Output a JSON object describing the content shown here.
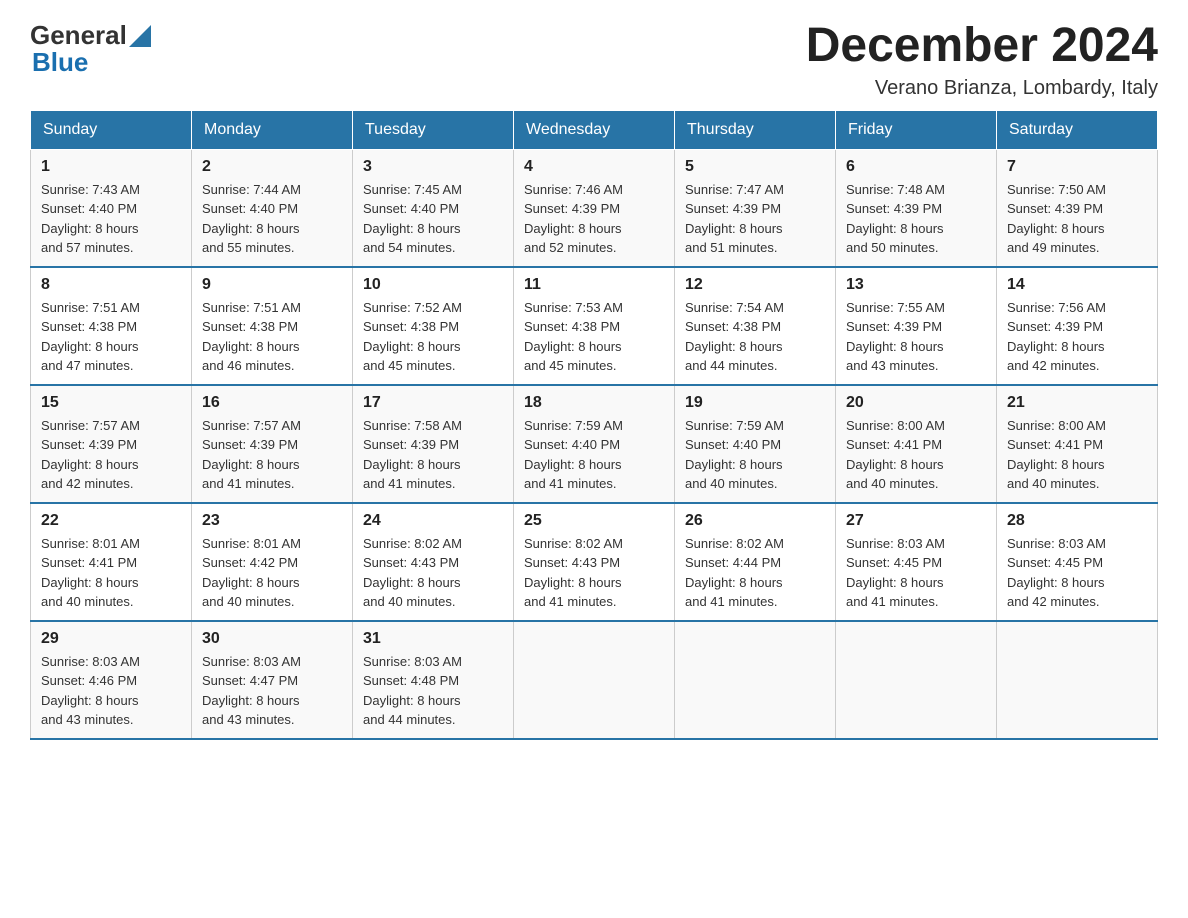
{
  "header": {
    "logo_general": "General",
    "logo_blue": "Blue",
    "month_title": "December 2024",
    "location": "Verano Brianza, Lombardy, Italy"
  },
  "days_of_week": [
    "Sunday",
    "Monday",
    "Tuesday",
    "Wednesday",
    "Thursday",
    "Friday",
    "Saturday"
  ],
  "weeks": [
    [
      {
        "day": "1",
        "sunrise": "7:43 AM",
        "sunset": "4:40 PM",
        "daylight_hours": "8",
        "daylight_minutes": "57"
      },
      {
        "day": "2",
        "sunrise": "7:44 AM",
        "sunset": "4:40 PM",
        "daylight_hours": "8",
        "daylight_minutes": "55"
      },
      {
        "day": "3",
        "sunrise": "7:45 AM",
        "sunset": "4:40 PM",
        "daylight_hours": "8",
        "daylight_minutes": "54"
      },
      {
        "day": "4",
        "sunrise": "7:46 AM",
        "sunset": "4:39 PM",
        "daylight_hours": "8",
        "daylight_minutes": "52"
      },
      {
        "day": "5",
        "sunrise": "7:47 AM",
        "sunset": "4:39 PM",
        "daylight_hours": "8",
        "daylight_minutes": "51"
      },
      {
        "day": "6",
        "sunrise": "7:48 AM",
        "sunset": "4:39 PM",
        "daylight_hours": "8",
        "daylight_minutes": "50"
      },
      {
        "day": "7",
        "sunrise": "7:50 AM",
        "sunset": "4:39 PM",
        "daylight_hours": "8",
        "daylight_minutes": "49"
      }
    ],
    [
      {
        "day": "8",
        "sunrise": "7:51 AM",
        "sunset": "4:38 PM",
        "daylight_hours": "8",
        "daylight_minutes": "47"
      },
      {
        "day": "9",
        "sunrise": "7:51 AM",
        "sunset": "4:38 PM",
        "daylight_hours": "8",
        "daylight_minutes": "46"
      },
      {
        "day": "10",
        "sunrise": "7:52 AM",
        "sunset": "4:38 PM",
        "daylight_hours": "8",
        "daylight_minutes": "45"
      },
      {
        "day": "11",
        "sunrise": "7:53 AM",
        "sunset": "4:38 PM",
        "daylight_hours": "8",
        "daylight_minutes": "45"
      },
      {
        "day": "12",
        "sunrise": "7:54 AM",
        "sunset": "4:38 PM",
        "daylight_hours": "8",
        "daylight_minutes": "44"
      },
      {
        "day": "13",
        "sunrise": "7:55 AM",
        "sunset": "4:39 PM",
        "daylight_hours": "8",
        "daylight_minutes": "43"
      },
      {
        "day": "14",
        "sunrise": "7:56 AM",
        "sunset": "4:39 PM",
        "daylight_hours": "8",
        "daylight_minutes": "42"
      }
    ],
    [
      {
        "day": "15",
        "sunrise": "7:57 AM",
        "sunset": "4:39 PM",
        "daylight_hours": "8",
        "daylight_minutes": "42"
      },
      {
        "day": "16",
        "sunrise": "7:57 AM",
        "sunset": "4:39 PM",
        "daylight_hours": "8",
        "daylight_minutes": "41"
      },
      {
        "day": "17",
        "sunrise": "7:58 AM",
        "sunset": "4:39 PM",
        "daylight_hours": "8",
        "daylight_minutes": "41"
      },
      {
        "day": "18",
        "sunrise": "7:59 AM",
        "sunset": "4:40 PM",
        "daylight_hours": "8",
        "daylight_minutes": "41"
      },
      {
        "day": "19",
        "sunrise": "7:59 AM",
        "sunset": "4:40 PM",
        "daylight_hours": "8",
        "daylight_minutes": "40"
      },
      {
        "day": "20",
        "sunrise": "8:00 AM",
        "sunset": "4:41 PM",
        "daylight_hours": "8",
        "daylight_minutes": "40"
      },
      {
        "day": "21",
        "sunrise": "8:00 AM",
        "sunset": "4:41 PM",
        "daylight_hours": "8",
        "daylight_minutes": "40"
      }
    ],
    [
      {
        "day": "22",
        "sunrise": "8:01 AM",
        "sunset": "4:41 PM",
        "daylight_hours": "8",
        "daylight_minutes": "40"
      },
      {
        "day": "23",
        "sunrise": "8:01 AM",
        "sunset": "4:42 PM",
        "daylight_hours": "8",
        "daylight_minutes": "40"
      },
      {
        "day": "24",
        "sunrise": "8:02 AM",
        "sunset": "4:43 PM",
        "daylight_hours": "8",
        "daylight_minutes": "40"
      },
      {
        "day": "25",
        "sunrise": "8:02 AM",
        "sunset": "4:43 PM",
        "daylight_hours": "8",
        "daylight_minutes": "41"
      },
      {
        "day": "26",
        "sunrise": "8:02 AM",
        "sunset": "4:44 PM",
        "daylight_hours": "8",
        "daylight_minutes": "41"
      },
      {
        "day": "27",
        "sunrise": "8:03 AM",
        "sunset": "4:45 PM",
        "daylight_hours": "8",
        "daylight_minutes": "41"
      },
      {
        "day": "28",
        "sunrise": "8:03 AM",
        "sunset": "4:45 PM",
        "daylight_hours": "8",
        "daylight_minutes": "42"
      }
    ],
    [
      {
        "day": "29",
        "sunrise": "8:03 AM",
        "sunset": "4:46 PM",
        "daylight_hours": "8",
        "daylight_minutes": "43"
      },
      {
        "day": "30",
        "sunrise": "8:03 AM",
        "sunset": "4:47 PM",
        "daylight_hours": "8",
        "daylight_minutes": "43"
      },
      {
        "day": "31",
        "sunrise": "8:03 AM",
        "sunset": "4:48 PM",
        "daylight_hours": "8",
        "daylight_minutes": "44"
      },
      null,
      null,
      null,
      null
    ]
  ]
}
